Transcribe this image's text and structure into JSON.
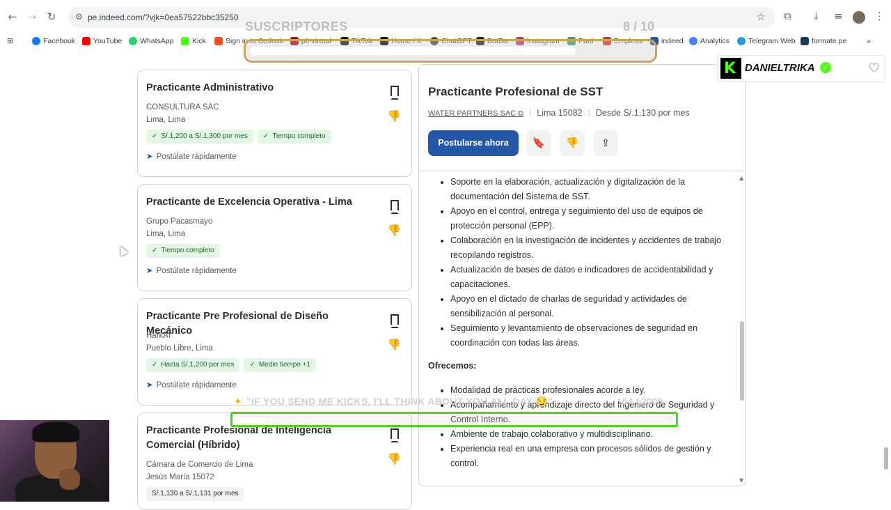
{
  "browser": {
    "url": "pe.indeed.com/?vjk=0ea57522bbc35250",
    "back_icon": "←",
    "forward_icon": "→",
    "reload_icon": "↻",
    "star_icon": "☆",
    "tune_icon": "⚙"
  },
  "bookmarks": [
    {
      "label": "Facebook",
      "color": "#1877f2"
    },
    {
      "label": "YouTube",
      "color": "#ff0000"
    },
    {
      "label": "WhatsApp",
      "color": "#25d366"
    },
    {
      "label": "Kick",
      "color": "#53fc18"
    },
    {
      "label": "Sign in to Outlook",
      "color": "#f25022"
    },
    {
      "label": "plt-virtual",
      "color": "#b00020"
    },
    {
      "label": "TikTok",
      "color": "#111111"
    },
    {
      "label": "Home / X",
      "color": "#000000"
    },
    {
      "label": "ChatGPT",
      "color": "#444444"
    },
    {
      "label": "BotBix",
      "color": "#222222"
    },
    {
      "label": "Instagram",
      "color": "#c13584"
    },
    {
      "label": "Parti",
      "color": "#3aa55d"
    },
    {
      "label": "Empleos",
      "color": "#d93025"
    },
    {
      "label": "indeed",
      "color": "#2557a7"
    },
    {
      "label": "Analytics",
      "color": "#4285f4"
    },
    {
      "label": "Telegram Web",
      "color": "#229ed9"
    },
    {
      "label": "formate.pe",
      "color": "#1a3a5c"
    }
  ],
  "overlay": {
    "subscribers_label": "SUSCRIPTORES",
    "subscribers_count": "8 / 10",
    "kick_message": "\"IF YOU SEND ME KICKS, I'LL THINK ABOUT YOU ALL DAY 😏\"",
    "kick_count": "154 / 2000",
    "streamer_name": "DANIELTRIKA"
  },
  "job_list": [
    {
      "title": "Practicante Administrativo",
      "company": "CONSULTURA SAC",
      "location": "Lima, Lima",
      "tags": [
        "S/.1,200 a S/.1,300 por mes",
        "Tiempo completo"
      ],
      "quick_apply": "Postúlate rápidamente"
    },
    {
      "title": "Practicante de Excelencia Operativa - Lima",
      "company": "Grupo Pacasmayo",
      "location": "Lima, Lima",
      "tags": [
        "Tiempo completo"
      ],
      "quick_apply": "Postúlate rápidamente"
    },
    {
      "title": "Practicante Pre Profesional de Diseño Mecánico",
      "company": "HarkAI",
      "location": "Pueblo Libre, Lima",
      "tags": [
        "Hasta S/.1,200 por mes",
        "Medio tiempo"
      ],
      "extra_tag": "+1",
      "quick_apply": "Postúlate rápidamente"
    },
    {
      "title": "Practicante Profesional de Inteligencia Comercial (Híbrido)",
      "company": "Cámara de Comercio de Lima",
      "location": "Jesús María 15072",
      "tags": [
        "S/.1,130 a S/.1,131 por mes"
      ]
    }
  ],
  "job_detail": {
    "title": "Practicante Profesional de SST",
    "company": "WATER PARTNERS SAC",
    "location": "Lima 15082",
    "salary": "Desde S/.1,130 por mes",
    "apply_label": "Postularse ahora",
    "responsibilities": [
      "Soporte en la elaboración, actualización y digitalización de la documentación del Sistema de SST.",
      "Apoyo en el control, entrega y seguimiento del uso de equipos de protección personal (EPP).",
      "Colaboración en la investigación de incidentes y accidentes de trabajo recopilando registros.",
      "Actualización de bases de datos e indicadores de accidentabilidad y capacitaciones.",
      "Apoyo en el dictado de charlas de seguridad y actividades de sensibilización al personal.",
      "Seguimiento y levantamiento de observaciones de seguridad en coordinación con todas las áreas."
    ],
    "offer_heading": "Ofrecemos:",
    "offers": [
      "Modalidad de prácticas profesionales acorde a ley.",
      "Acompañamiento y aprendizaje directo del Ingeniero de Seguridad y Control Interno.",
      "Ambiente de trabajo colaborativo y multidisciplinario.",
      "Experiencia real en una empresa con procesos sólidos de gestión y control."
    ]
  }
}
